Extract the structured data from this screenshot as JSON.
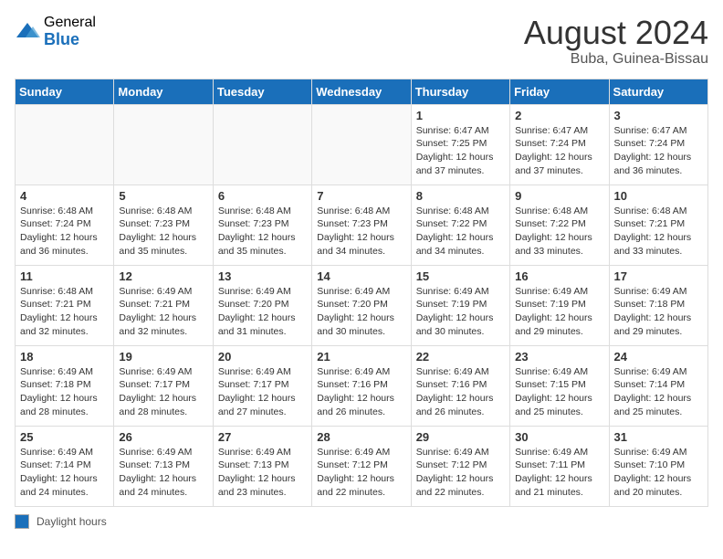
{
  "logo": {
    "general": "General",
    "blue": "Blue"
  },
  "title": {
    "month_year": "August 2024",
    "location": "Buba, Guinea-Bissau"
  },
  "days_of_week": [
    "Sunday",
    "Monday",
    "Tuesday",
    "Wednesday",
    "Thursday",
    "Friday",
    "Saturday"
  ],
  "legend": {
    "label": "Daylight hours"
  },
  "weeks": [
    [
      {
        "day": "",
        "info": ""
      },
      {
        "day": "",
        "info": ""
      },
      {
        "day": "",
        "info": ""
      },
      {
        "day": "",
        "info": ""
      },
      {
        "day": "1",
        "info": "Sunrise: 6:47 AM\nSunset: 7:25 PM\nDaylight: 12 hours\nand 37 minutes."
      },
      {
        "day": "2",
        "info": "Sunrise: 6:47 AM\nSunset: 7:24 PM\nDaylight: 12 hours\nand 37 minutes."
      },
      {
        "day": "3",
        "info": "Sunrise: 6:47 AM\nSunset: 7:24 PM\nDaylight: 12 hours\nand 36 minutes."
      }
    ],
    [
      {
        "day": "4",
        "info": "Sunrise: 6:48 AM\nSunset: 7:24 PM\nDaylight: 12 hours\nand 36 minutes."
      },
      {
        "day": "5",
        "info": "Sunrise: 6:48 AM\nSunset: 7:23 PM\nDaylight: 12 hours\nand 35 minutes."
      },
      {
        "day": "6",
        "info": "Sunrise: 6:48 AM\nSunset: 7:23 PM\nDaylight: 12 hours\nand 35 minutes."
      },
      {
        "day": "7",
        "info": "Sunrise: 6:48 AM\nSunset: 7:23 PM\nDaylight: 12 hours\nand 34 minutes."
      },
      {
        "day": "8",
        "info": "Sunrise: 6:48 AM\nSunset: 7:22 PM\nDaylight: 12 hours\nand 34 minutes."
      },
      {
        "day": "9",
        "info": "Sunrise: 6:48 AM\nSunset: 7:22 PM\nDaylight: 12 hours\nand 33 minutes."
      },
      {
        "day": "10",
        "info": "Sunrise: 6:48 AM\nSunset: 7:21 PM\nDaylight: 12 hours\nand 33 minutes."
      }
    ],
    [
      {
        "day": "11",
        "info": "Sunrise: 6:48 AM\nSunset: 7:21 PM\nDaylight: 12 hours\nand 32 minutes."
      },
      {
        "day": "12",
        "info": "Sunrise: 6:49 AM\nSunset: 7:21 PM\nDaylight: 12 hours\nand 32 minutes."
      },
      {
        "day": "13",
        "info": "Sunrise: 6:49 AM\nSunset: 7:20 PM\nDaylight: 12 hours\nand 31 minutes."
      },
      {
        "day": "14",
        "info": "Sunrise: 6:49 AM\nSunset: 7:20 PM\nDaylight: 12 hours\nand 30 minutes."
      },
      {
        "day": "15",
        "info": "Sunrise: 6:49 AM\nSunset: 7:19 PM\nDaylight: 12 hours\nand 30 minutes."
      },
      {
        "day": "16",
        "info": "Sunrise: 6:49 AM\nSunset: 7:19 PM\nDaylight: 12 hours\nand 29 minutes."
      },
      {
        "day": "17",
        "info": "Sunrise: 6:49 AM\nSunset: 7:18 PM\nDaylight: 12 hours\nand 29 minutes."
      }
    ],
    [
      {
        "day": "18",
        "info": "Sunrise: 6:49 AM\nSunset: 7:18 PM\nDaylight: 12 hours\nand 28 minutes."
      },
      {
        "day": "19",
        "info": "Sunrise: 6:49 AM\nSunset: 7:17 PM\nDaylight: 12 hours\nand 28 minutes."
      },
      {
        "day": "20",
        "info": "Sunrise: 6:49 AM\nSunset: 7:17 PM\nDaylight: 12 hours\nand 27 minutes."
      },
      {
        "day": "21",
        "info": "Sunrise: 6:49 AM\nSunset: 7:16 PM\nDaylight: 12 hours\nand 26 minutes."
      },
      {
        "day": "22",
        "info": "Sunrise: 6:49 AM\nSunset: 7:16 PM\nDaylight: 12 hours\nand 26 minutes."
      },
      {
        "day": "23",
        "info": "Sunrise: 6:49 AM\nSunset: 7:15 PM\nDaylight: 12 hours\nand 25 minutes."
      },
      {
        "day": "24",
        "info": "Sunrise: 6:49 AM\nSunset: 7:14 PM\nDaylight: 12 hours\nand 25 minutes."
      }
    ],
    [
      {
        "day": "25",
        "info": "Sunrise: 6:49 AM\nSunset: 7:14 PM\nDaylight: 12 hours\nand 24 minutes."
      },
      {
        "day": "26",
        "info": "Sunrise: 6:49 AM\nSunset: 7:13 PM\nDaylight: 12 hours\nand 24 minutes."
      },
      {
        "day": "27",
        "info": "Sunrise: 6:49 AM\nSunset: 7:13 PM\nDaylight: 12 hours\nand 23 minutes."
      },
      {
        "day": "28",
        "info": "Sunrise: 6:49 AM\nSunset: 7:12 PM\nDaylight: 12 hours\nand 22 minutes."
      },
      {
        "day": "29",
        "info": "Sunrise: 6:49 AM\nSunset: 7:12 PM\nDaylight: 12 hours\nand 22 minutes."
      },
      {
        "day": "30",
        "info": "Sunrise: 6:49 AM\nSunset: 7:11 PM\nDaylight: 12 hours\nand 21 minutes."
      },
      {
        "day": "31",
        "info": "Sunrise: 6:49 AM\nSunset: 7:10 PM\nDaylight: 12 hours\nand 20 minutes."
      }
    ]
  ]
}
